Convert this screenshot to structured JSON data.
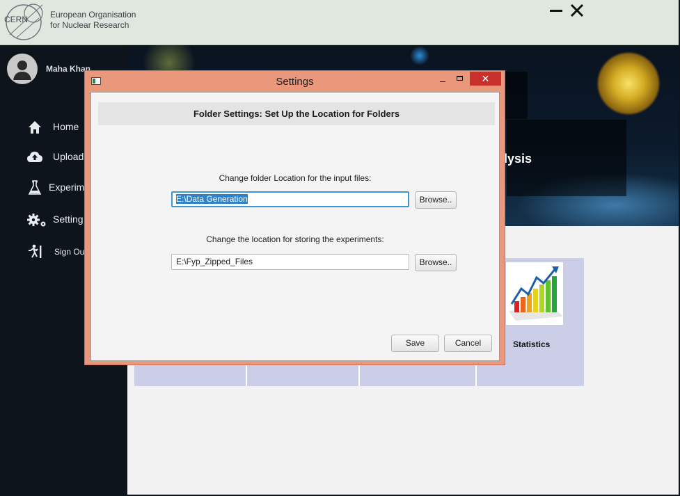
{
  "header": {
    "logo_text": "CERN",
    "org_line1": "European Organisation",
    "org_line2": "for Nuclear Research"
  },
  "sidebar": {
    "user_name": "Maha Khan",
    "items": [
      {
        "label": "Home",
        "icon": "home-icon"
      },
      {
        "label": "Upload",
        "icon": "cloud-upload-icon"
      },
      {
        "label": "Experim",
        "icon": "flask-icon"
      },
      {
        "label": "Setting",
        "icon": "gears-icon"
      },
      {
        "label": "Sign Ou",
        "icon": "exit-icon"
      }
    ]
  },
  "main": {
    "banner_title": "alysis",
    "tiles": [
      {
        "label": ""
      },
      {
        "label": ""
      },
      {
        "label": ""
      },
      {
        "label": "Statistics"
      }
    ]
  },
  "dialog": {
    "title": "Settings",
    "close_glyph": "✕",
    "header": "Folder Settings: Set Up the Location for Folders",
    "input_label": "Change folder Location for the input files:",
    "input_value": "E:\\Data Generation",
    "storage_label": "Change the location for storing the experiments:",
    "storage_value": "E:\\Fyp_Zipped_Files",
    "browse_label": "Browse..",
    "save_label": "Save",
    "cancel_label": "Cancel"
  },
  "colors": {
    "dialog_frame": "#e9987c",
    "close_red": "#c7302b",
    "selection_blue": "#2e82c8",
    "sidebar_bg": "#0d141c",
    "tile_bg": "#cccde6"
  }
}
